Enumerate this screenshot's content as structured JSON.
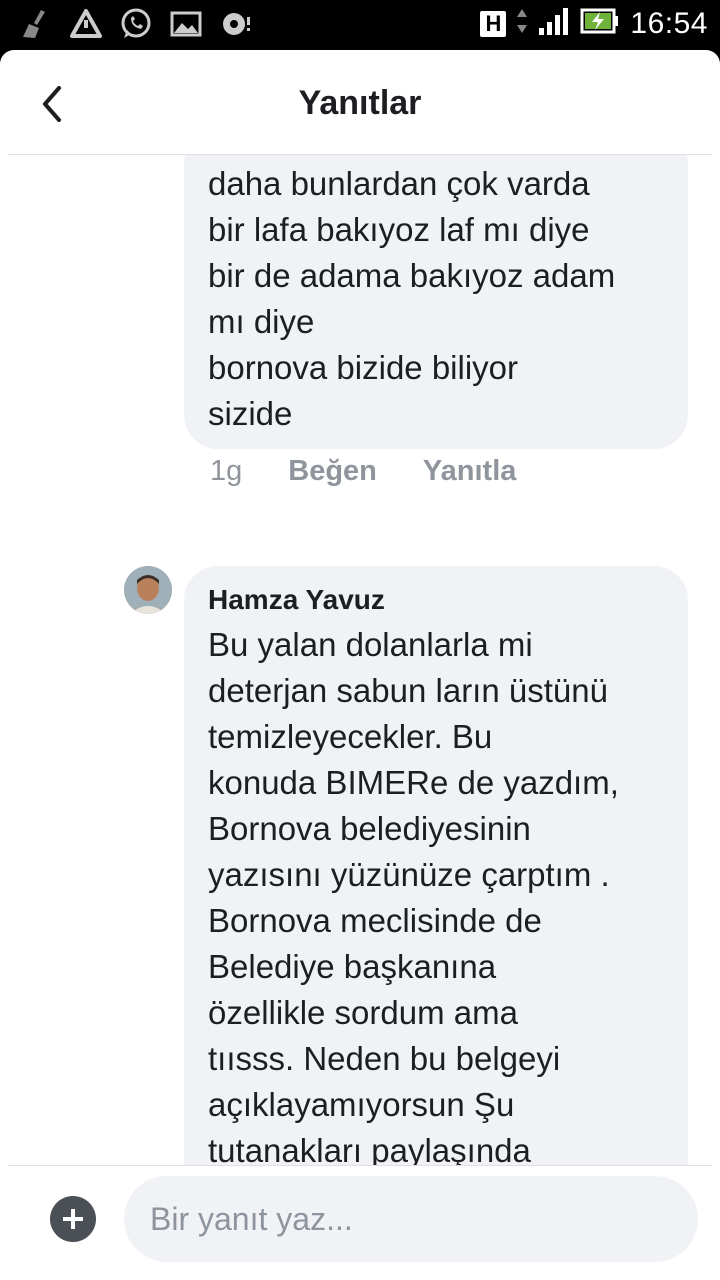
{
  "status_bar": {
    "time": "16:54",
    "network_badge": "H",
    "left_icons": [
      "broom-icon",
      "warning-icon",
      "whatsapp-icon",
      "gallery-icon",
      "media-notification-icon"
    ]
  },
  "header": {
    "title": "Yanıtlar",
    "back_icon": "chevron-left-icon"
  },
  "replies": [
    {
      "author": "",
      "text": "daha bunlardan çok varda\nbir lafa bakıyoz laf mı diye\nbir de adama bakıyoz adam\nmı diye\nbornova bizide biliyor\nsizide",
      "time": "1g",
      "like_label": "Beğen",
      "reply_label": "Yanıtla"
    },
    {
      "author": "Hamza Yavuz",
      "text": "Bu yalan dolanlarla mi\ndeterjan sabun ların üstünü\ntemizleyecekler. Bu\nkonuda BIMERe de yazdım,\nBornova belediyesinin\nyazısını yüzünüze çarptım .\nBornova meclisinde de\nBelediye başkanına\nözellikle sordum ama\ntıısss. Neden bu belgeyi\naçıklayamıyorsun Şu\ntutanakları paylaşında\nbizde görelim, .... Gezi"
    }
  ],
  "composer": {
    "placeholder": "Bir yanıt yaz...",
    "add_icon": "plus-icon"
  },
  "colors": {
    "bubble": "#f0f2f5",
    "text": "#1c1e21",
    "muted": "#90949c"
  }
}
